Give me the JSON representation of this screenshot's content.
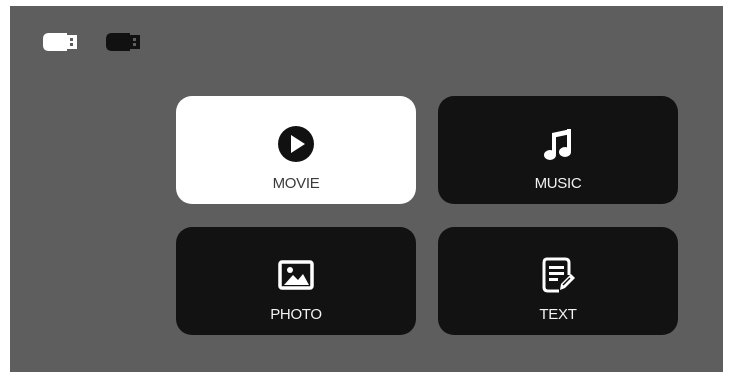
{
  "status": {
    "usb_icons": [
      "usb-connected-icon",
      "usb-disconnected-icon"
    ]
  },
  "menu": {
    "items": [
      {
        "label": "MOVIE",
        "icon": "play-circle-icon",
        "selected": true
      },
      {
        "label": "MUSIC",
        "icon": "music-note-icon",
        "selected": false
      },
      {
        "label": "PHOTO",
        "icon": "image-icon",
        "selected": false
      },
      {
        "label": "TEXT",
        "icon": "text-document-icon",
        "selected": false
      }
    ]
  },
  "colors": {
    "background": "#5e5e5e",
    "tile": "#121212",
    "tile_selected": "#ffffff"
  }
}
